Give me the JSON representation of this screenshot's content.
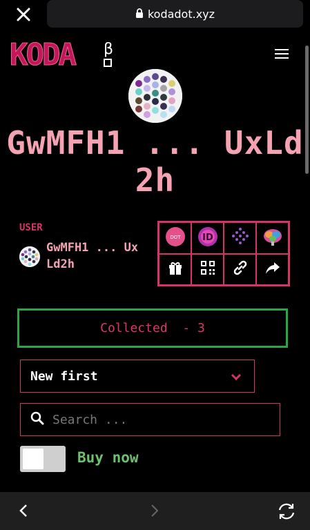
{
  "browser": {
    "url": "kodadot.xyz",
    "close_icon": "close-icon",
    "lock_icon": "lock-icon"
  },
  "header": {
    "logo_text": "KODA",
    "logo_badge": "β",
    "menu_icon": "hamburger-menu-icon"
  },
  "profile": {
    "title": "GwMFH1 ... UxLd 2h"
  },
  "user": {
    "label": "USER",
    "name": "GwMFH1 ... Ux Ld2h"
  },
  "icon_links": [
    {
      "name": "dotscanner-icon",
      "label": "DOT"
    },
    {
      "name": "kodadot-identity-icon",
      "label": "ID"
    },
    {
      "name": "subscan-icon"
    },
    {
      "name": "brain-icon"
    },
    {
      "name": "gift-icon"
    },
    {
      "name": "qr-code-icon"
    },
    {
      "name": "link-icon"
    },
    {
      "name": "share-icon"
    }
  ],
  "tabs": {
    "collected_label": "Collected",
    "collected_count": "- 3"
  },
  "sort": {
    "selected": "New first"
  },
  "search": {
    "placeholder": "Search ..."
  },
  "filter": {
    "buy_now_label": "Buy now",
    "buy_now_on": false
  },
  "colors": {
    "accent": "#d6336c",
    "title_pink": "#f5a3b3",
    "active_tab_border": "#28a745",
    "buy_now_green": "#6ec06e"
  }
}
